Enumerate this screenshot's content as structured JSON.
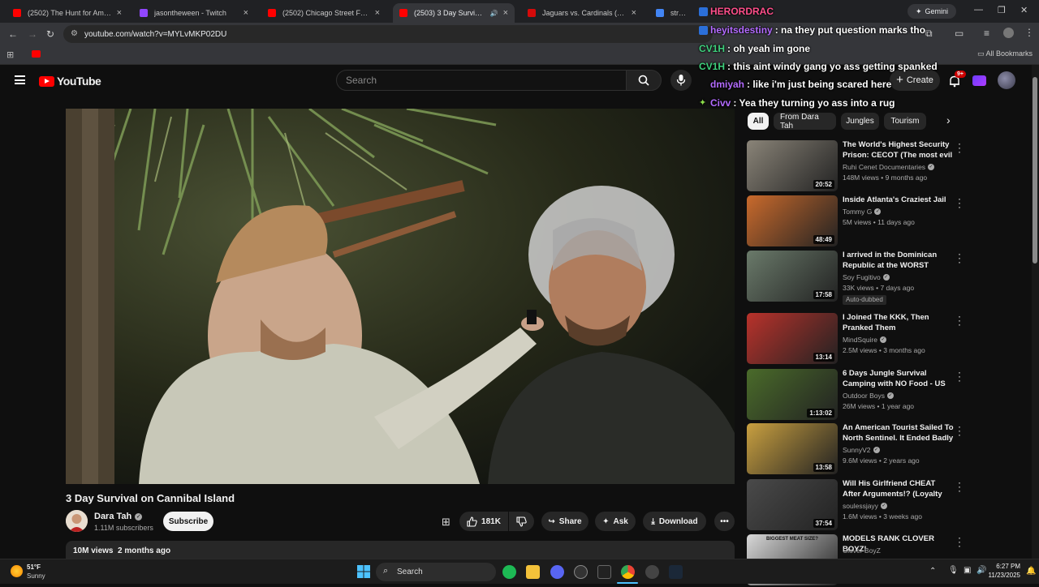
{
  "browser": {
    "tabs": [
      {
        "title": "(2502) The Hunt for America's S",
        "favicon_color": "#ff0000"
      },
      {
        "title": "jasontheween - Twitch",
        "favicon_color": "#9146ff"
      },
      {
        "title": "(2502) Chicago Street Food!! 5",
        "favicon_color": "#ff0000"
      },
      {
        "title": "(2503) 3 Day Survival on Ca",
        "favicon_color": "#ff0000",
        "active": true,
        "audio": true
      },
      {
        "title": "Jaguars vs. Cardinals (Nov 23, 2",
        "favicon_color": "#d50a0a"
      },
      {
        "title": "stranger th",
        "favicon_color": "#4285f4"
      }
    ],
    "gemini_label": "Gemini",
    "url": "youtube.com/watch?v=MYLvMKP02DU",
    "all_bookmarks": "All Bookmarks"
  },
  "youtube": {
    "logo": "YouTube",
    "search_placeholder": "Search",
    "create_label": "Create",
    "notif_count": "9+"
  },
  "video": {
    "title": "3 Day Survival on Cannibal Island",
    "channel": "Dara Tah",
    "subscribers": "1.11M subscribers",
    "subscribe_label": "Subscribe",
    "likes": "181K",
    "share_label": "Share",
    "ask_label": "Ask",
    "download_label": "Download",
    "views": "10M views",
    "age": "2 months ago"
  },
  "chips": [
    "All",
    "From Dara Tah",
    "Jungles",
    "Tourism"
  ],
  "recommendations": [
    {
      "title": "The World's Highest Security Prison: CECOT (The most evil ...",
      "channel": "Ruhi Cenet Documentaries",
      "verified": true,
      "views": "148M views",
      "age": "9 months ago",
      "duration": "20:52",
      "thumb_color": "#8a8478"
    },
    {
      "title": "Inside Atlanta's Craziest Jail",
      "channel": "Tommy G",
      "verified": true,
      "views": "5M views",
      "age": "11 days ago",
      "duration": "48:49",
      "thumb_color": "#c96a2c"
    },
    {
      "title": "I arrived in the Dominican Republic at the WORST possib...",
      "channel": "Soy Fugitivo",
      "verified": true,
      "views": "33K views",
      "age": "7 days ago",
      "duration": "17:58",
      "thumb_color": "#6a7a6a",
      "badge": "Auto-dubbed"
    },
    {
      "title": "I Joined The KKK, Then Pranked Them",
      "channel": "MindSquire",
      "verified": true,
      "views": "2.5M views",
      "age": "3 months ago",
      "duration": "13:14",
      "thumb_color": "#b9322b"
    },
    {
      "title": "6 Days Jungle Survival Camping with NO Food - US Marine Cor...",
      "channel": "Outdoor Boys",
      "verified": true,
      "views": "26M views",
      "age": "1 year ago",
      "duration": "1:13:02",
      "thumb_color": "#4a6b2a"
    },
    {
      "title": "An American Tourist Sailed To North Sentinel. It Ended Badly",
      "channel": "SunnyV2",
      "verified": true,
      "views": "9.6M views",
      "age": "2 years ago",
      "duration": "13:58",
      "thumb_color": "#c9a040"
    },
    {
      "title": "Will His Girlfriend CHEAT After Arguments!? (Loyalty Test) ...",
      "channel": "soulessjayy",
      "verified": true,
      "views": "1.6M views",
      "age": "3 weeks ago",
      "duration": "37:54",
      "thumb_color": "#4a4a4a"
    },
    {
      "title": "MODELS RANK CLOVER BOYZ!",
      "channel": "Clover BoyZ",
      "verified": false,
      "views": "",
      "age": "",
      "duration": "",
      "thumb_color": "#d8d8d8",
      "thumb_text": "BIGGEST MEAT SIZE?"
    }
  ],
  "chat": [
    {
      "user": "HERORDRAC",
      "text": "",
      "color": "#ff4f8b"
    },
    {
      "user": "heyitsdestiny",
      "text": ": na they put question marks tho",
      "color": "#b36bff"
    },
    {
      "user": "CV1H",
      "text": ": oh yeah im gone",
      "color": "#3fd07d"
    },
    {
      "user": "CV1H",
      "text": ": this aint windy gang yo ass getting spanked",
      "color": "#3fd07d"
    },
    {
      "user": "dmiyah",
      "text": ": like i'm just being scared here",
      "color": "#b36bff"
    },
    {
      "user": "Civv",
      "text": ": Yea they turning yo ass into a rug",
      "color": "#b36bff"
    }
  ],
  "taskbar": {
    "weather_temp": "51°F",
    "weather_desc": "Sunny",
    "search_label": "Search",
    "time": "6:27 PM",
    "date": "11/23/2025"
  }
}
